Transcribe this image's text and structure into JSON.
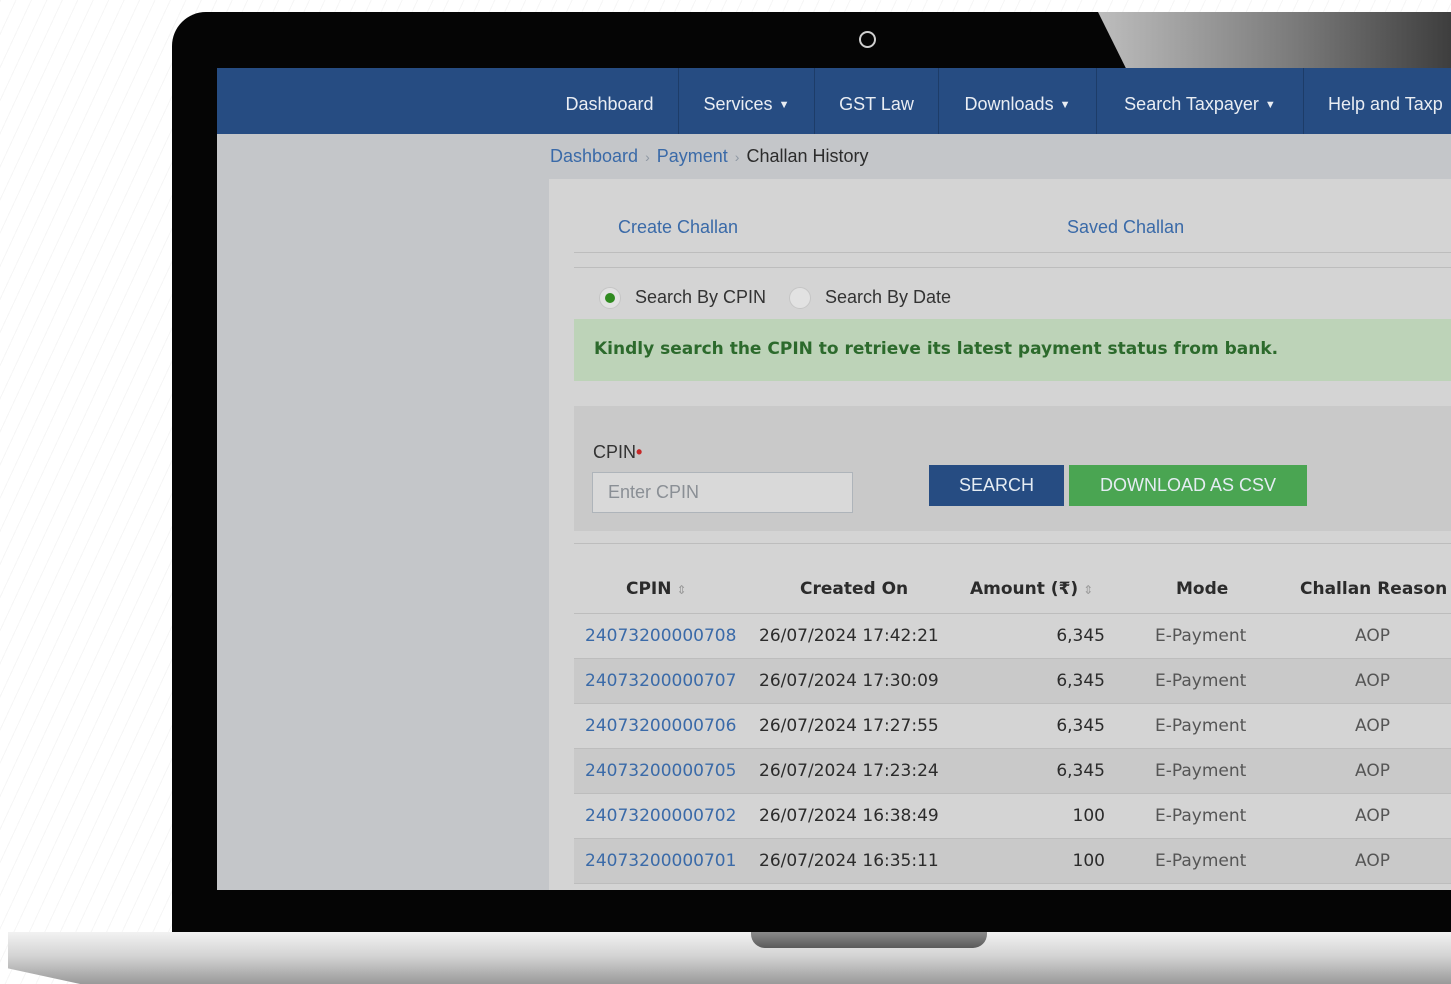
{
  "nav": {
    "dashboard": "Dashboard",
    "services": "Services",
    "gst_law": "GST Law",
    "downloads": "Downloads",
    "search_taxpayer": "Search Taxpayer",
    "help": "Help and Taxp"
  },
  "breadcrumb": {
    "items": [
      "Dashboard",
      "Payment"
    ],
    "current": "Challan History"
  },
  "tabs": {
    "create": "Create Challan",
    "saved": "Saved Challan"
  },
  "search_mode": {
    "by_cpin": "Search By CPIN",
    "by_date": "Search By Date",
    "selected": "Search By CPIN"
  },
  "alert": {
    "message": "Kindly search the CPIN to retrieve its latest payment status from bank."
  },
  "form": {
    "cpin_label": "CPIN",
    "required_mark": "•",
    "cpin_placeholder": "Enter CPIN",
    "search_button": "SEARCH",
    "download_button": "DOWNLOAD AS CSV"
  },
  "table": {
    "headers": {
      "cpin": "CPIN",
      "created_on": "Created On",
      "amount": "Amount (₹)",
      "mode": "Mode",
      "reason": "Challan Reason"
    },
    "sort_icon": "⇕",
    "rows": [
      {
        "cpin": "24073200000708",
        "created_on": "26/07/2024 17:42:21",
        "amount": "6,345",
        "mode": "E-Payment",
        "reason": "AOP"
      },
      {
        "cpin": "24073200000707",
        "created_on": "26/07/2024 17:30:09",
        "amount": "6,345",
        "mode": "E-Payment",
        "reason": "AOP"
      },
      {
        "cpin": "24073200000706",
        "created_on": "26/07/2024 17:27:55",
        "amount": "6,345",
        "mode": "E-Payment",
        "reason": "AOP"
      },
      {
        "cpin": "24073200000705",
        "created_on": "26/07/2024 17:23:24",
        "amount": "6,345",
        "mode": "E-Payment",
        "reason": "AOP"
      },
      {
        "cpin": "24073200000702",
        "created_on": "26/07/2024 16:38:49",
        "amount": "100",
        "mode": "E-Payment",
        "reason": "AOP"
      },
      {
        "cpin": "24073200000701",
        "created_on": "26/07/2024 16:35:11",
        "amount": "100",
        "mode": "E-Payment",
        "reason": "AOP"
      }
    ]
  },
  "colors": {
    "navbar": "#264c82",
    "link": "#3a6aa8",
    "alert_bg": "#bdd3b8",
    "alert_text": "#2c6a2c",
    "download_button": "#4aa552"
  }
}
